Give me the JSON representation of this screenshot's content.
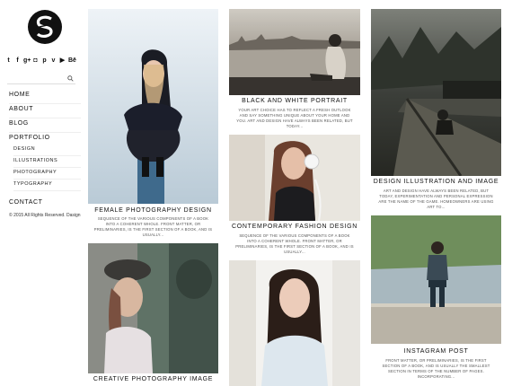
{
  "sidebar": {
    "logo_letter": "S",
    "social_icons": [
      {
        "name": "twitter-icon",
        "glyph": "t"
      },
      {
        "name": "facebook-icon",
        "glyph": "f"
      },
      {
        "name": "google-plus-icon",
        "glyph": "g+"
      },
      {
        "name": "instagram-icon",
        "glyph": "◘"
      },
      {
        "name": "pinterest-icon",
        "glyph": "p"
      },
      {
        "name": "vimeo-icon",
        "glyph": "v"
      },
      {
        "name": "youtube-icon",
        "glyph": "▶"
      },
      {
        "name": "behance-icon",
        "glyph": "Bē"
      }
    ],
    "nav": {
      "home": "HOME",
      "about": "ABOUT",
      "blog": "BLOG",
      "portfolio": "PORTFOLIO",
      "portfolio_sub": [
        "DESIGN",
        "ILLUSTRATIONS",
        "PHOTOGRAPHY",
        "TYPOGRAPHY"
      ],
      "contact": "CONTACT"
    },
    "copyright": "© 2015 All Rights Reserved. Dasign"
  },
  "cards": {
    "female": {
      "title": "FEMALE PHOTOGRAPHY DESIGN",
      "desc": "SEQUENCE OF THE VARIOUS COMPONENTS OF A BOOK INTO A COHERENT WHOLE. FRONT MATTER, OR PRELIMINARIES, IS THE FIRST SECTION OF A BOOK, AND IS USUALLY..."
    },
    "creative": {
      "title": "CREATIVE PHOTOGRAPHY IMAGE"
    },
    "bw": {
      "title": "BLACK AND WHITE PORTRAIT",
      "desc": "YOUR ART CHOICE HAS TO REFLECT A FRESH OUTLOOK AND SAY SOMETHING UNIQUE ABOUT YOUR HOME AND YOU. ART AND DESIGN HAVE ALWAYS BEEN RELATED, BUT TODAY..."
    },
    "fashion": {
      "title": "CONTEMPORARY FASHION DESIGN",
      "desc": "SEQUENCE OF THE VARIOUS COMPONENTS OF A BOOK INTO A COHERENT WHOLE. FRONT MATTER, OR PRELIMINARIES, IS THE FIRST SECTION OF A BOOK, AND IS USUALLY..."
    },
    "illustration": {
      "title": "DESIGN ILLUSTRATION AND IMAGE",
      "desc": "ART AND DESIGN HAVE ALWAYS BEEN RELATED, BUT TODAY, EXPERIMENTATION AND PERSONAL EXPRESSION ARE THE NAME OF THE GAME. HOMEOWNERS ARE USING ART TO..."
    },
    "instagram": {
      "title": "INSTAGRAM POST",
      "desc": "FRONT MATTER, OR PRELIMINARIES, IS THE FIRST SECTION OF A BOOK, AND IS USUALLY THE SMALLEST SECTION IN TERMS OF THE NUMBER OF PAGES. INCORPORATING..."
    }
  }
}
